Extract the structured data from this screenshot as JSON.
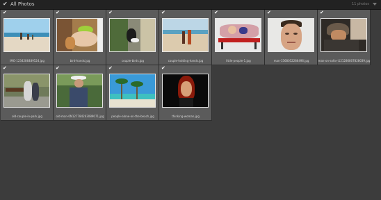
{
  "header": {
    "title": "All Photos",
    "photo_count": "11 photos"
  },
  "photos": [
    {
      "filename": "IMG-1234286489524.jpg"
    },
    {
      "filename": "bird-hands.jpg"
    },
    {
      "filename": "couple-birds.jpg"
    },
    {
      "filename": "couple-holding-hands.jpg"
    },
    {
      "filename": "little-people-1.jpg"
    },
    {
      "filename": "man-1568052286496.jpg"
    },
    {
      "filename": "man-on-sofa-n121286807828039.jpg"
    },
    {
      "filename": "old-couple-in-park.jpg"
    },
    {
      "filename": "old-man-0N127784263089071.jpg"
    },
    {
      "filename": "people-alone-on-the-beach.jpg"
    },
    {
      "filename": "thinking-woman.jpg"
    }
  ]
}
